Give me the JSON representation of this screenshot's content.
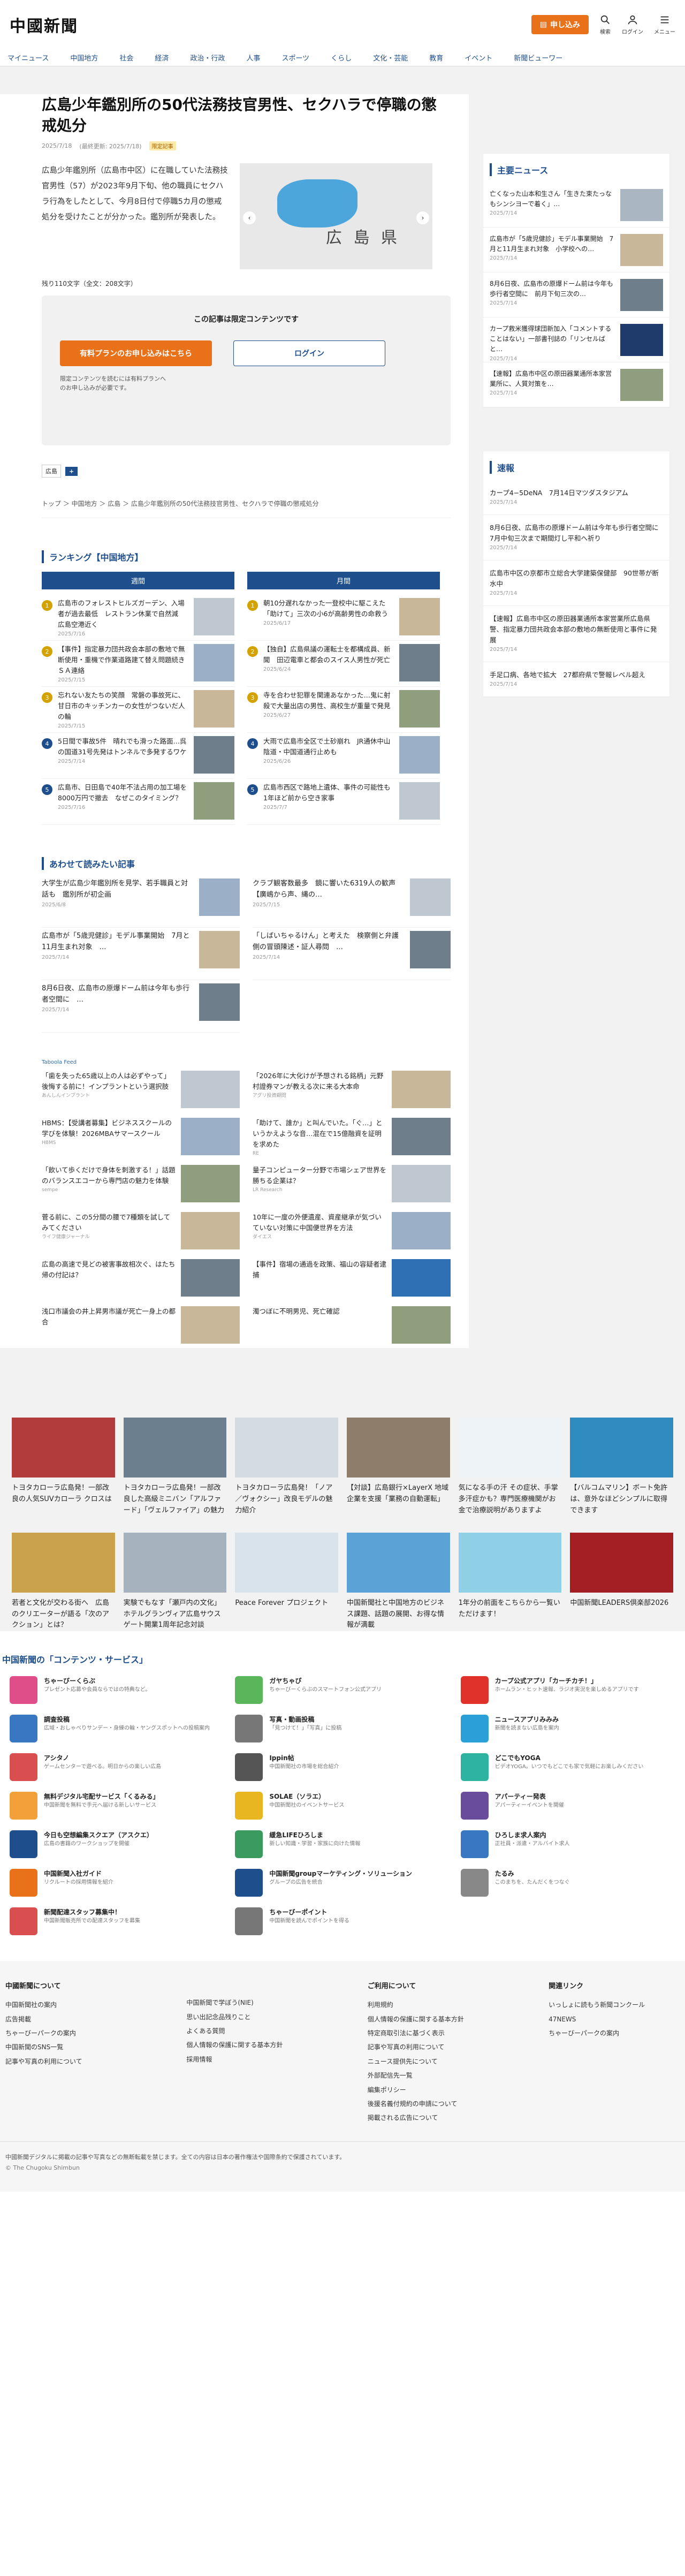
{
  "header": {
    "logo": "中國新聞",
    "apply": "申し込み",
    "icons": [
      {
        "label": "検索"
      },
      {
        "label": "ログイン"
      },
      {
        "label": "メニュー"
      }
    ]
  },
  "nav": [
    "マイニュース",
    "中国地方",
    "社会",
    "経済",
    "政治・行政",
    "人事",
    "スポーツ",
    "くらし",
    "文化・芸能",
    "教育",
    "イベント",
    "新聞ビューワー"
  ],
  "article": {
    "title": "広島少年鑑別所の50代法務技官男性、セクハラで停職の懲戒処分",
    "date": "2025/7/18",
    "updated": "(最終更新: 2025/7/18)",
    "badge": "限定記事",
    "body": "広島少年鑑別所（広島市中区）に在職していた法務技官男性（57）が2023年9月下旬、他の職員にセクハラ行為をしたとして、今月8日付で停職5カ月の懲戒処分を受けたことが分かった。鑑別所が発表した。",
    "map_label": "広 島 県",
    "remain": "残り110文字（全文：208文字）",
    "locked_title": "この記事は限定コンテンツです",
    "btn_plan": "有料プランのお申し込みはこちら",
    "btn_login": "ログイン",
    "lock_note": "限定コンテンツを読むには有料プランへのお申し込みが必要です。",
    "tag": "広島",
    "breadcrumb": "トップ ＞ 中国地方 ＞ 広島 ＞ 広島少年鑑別所の50代法務技官男性、セクハラで停職の懲戒処分"
  },
  "ranking": {
    "title": "ランキング【中国地方】",
    "weekly_label": "週間",
    "monthly_label": "月間",
    "weekly": [
      {
        "n": "1",
        "t": "広島市のフォレストヒルズガーデン、入場者が過去最低　レストラン休業で自然減　広島空港近く",
        "d": "2025/7/16"
      },
      {
        "n": "2",
        "t": "【事件】指定暴力団共政会本部の敷地で無断使用・重機で作業道路建て替え問題続きＳＡ連絡",
        "d": "2025/7/15"
      },
      {
        "n": "3",
        "t": "忘れない友たちの笑顔　常磐の事故死に、甘日市のキッチンカーの女性がつないだ人の輪",
        "d": "2025/7/15"
      },
      {
        "n": "4",
        "t": "5日間で事故5件　晴れでも滑った路面…呉の国道31号先発はトンネルで多発するワケ",
        "d": "2025/7/14"
      },
      {
        "n": "5",
        "t": "広島市、日田島で40年不法占用の加工場を8000万円で撤去　なぜこのタイミング？",
        "d": "2025/7/16"
      }
    ],
    "monthly": [
      {
        "n": "1",
        "t": "朝10分遅れなかった一登校中に駆こえた「助けて」三次の小6が高齢男性の命救う",
        "d": "2025/6/17"
      },
      {
        "n": "2",
        "t": "【独自】広島県議の運転士を都構成員、新聞　田辺電車と都会のスイス人男性が死亡",
        "d": "2025/6/24"
      },
      {
        "n": "3",
        "t": "寺を合わせ犯罪を関連あなかった…鬼に射殺で大量出店の男性、高校生が重量で発見",
        "d": "2025/6/27"
      },
      {
        "n": "4",
        "t": "大雨で広島市全区で土砂崩れ　JR通休中山陰道・中国道通行止めも",
        "d": "2025/6/26"
      },
      {
        "n": "5",
        "t": "広島市西区で路地上遺体、事件の可能性も　1年ほど前から空き家事",
        "d": "2025/7/7"
      }
    ]
  },
  "related": {
    "title": "あわせて読みたい記事",
    "items": [
      {
        "t": "大学生が広島少年鑑別所を見学、若手職員と対話も　鑑別所が初企画",
        "d": "2025/6/8"
      },
      {
        "t": "クラブ観客数最多　鏡に響いた6319人の歓声【廣嶋から声、縄の…",
        "d": "2025/7/15"
      },
      {
        "t": "広島市が「5歳児健診」モデル事業開始　7月と11月生まれ対象　…",
        "d": "2025/7/14"
      },
      {
        "t": "「しばいちゃるけん」と考えた　検察側と弁護側の冒頭陳述・証人尋問　…",
        "d": "2025/7/14"
      },
      {
        "t": "8月6日夜、広島市の原爆ドーム前は今年も歩行者空間に　…",
        "d": "2025/7/14"
      }
    ]
  },
  "ads": {
    "tag": "Taboola Feed",
    "items": [
      {
        "t": "「歯を失った65歳以上の人は必ずやって」後悔する前に！インプラントという選択肢",
        "s": "あんしんインプラント"
      },
      {
        "t": "「2026年に大化けが予想される銘柄」元野村證券マンが教える次に来る大本命",
        "s": "アグリ投資顧問"
      },
      {
        "t": "HBMS：【受講者募集】ビジネススクールの学びを体験！2026MBAサマースクール",
        "s": "HBMS"
      },
      {
        "t": "「助けて、誰か」と叫んでいた。「ぐ…」というかえような音…混在で15億融資を証明を求めた",
        "s": "RE"
      },
      {
        "t": "「飲いて歩くだけで身体を刺激する！」話題のバランスエコーから専門店の魅力を体験",
        "s": "sempe"
      },
      {
        "t": "量子コンピューター分野で市場シェア世界を勝ちる企業は？",
        "s": "LR Research"
      },
      {
        "t": "菅る前に、この5分間の腰で7種類を試してみてください",
        "s": "ライフ健康ジャーナル"
      },
      {
        "t": "10年に一度の外便遺産、資産継承が気づいていない対策に中国便世界を方法",
        "s": "ダイエス"
      },
      {
        "t": "広島の高速で見どの被害事故相次ぐ、はたち帰の付記は？",
        "s": ""
      },
      {
        "t": "【事件】宿場の通過を政策、福山の容疑者逮捕",
        "s": ""
      },
      {
        "t": "浅口市議会の井上昇男市議が死亡一身上の都合",
        "s": ""
      },
      {
        "t": "濁つぼに不明男児、死亡確認",
        "s": ""
      }
    ]
  },
  "side": {
    "main_title": "主要ニュース",
    "main": [
      {
        "t": "亡くなった山本和生さん「生きた束たっなもシンシヨーで着く」…",
        "d": "2025/7/14"
      },
      {
        "t": "広島市が「5歳児健診」モデル事業開始　7月と11月生まれ対象　小学校への…",
        "d": "2025/7/14"
      },
      {
        "t": "8月6日夜、広島市の原爆ドーム前は今年も歩行者空間に　前月下旬三次の…",
        "d": "2025/7/14"
      },
      {
        "t": "カープ救米獲得球団新加入「コメントすることはない」一部書刊誌の「リンセルばと…",
        "d": "2025/7/14"
      },
      {
        "t": "【速報】広島市中区の原田器業通所本家営業所に、人質対策を…",
        "d": "2025/7/14"
      }
    ],
    "flash_title": "速報",
    "flash": [
      {
        "t": "カープ4−5DeNA　7月14日マツダスタジアム",
        "d": "2025/7/14"
      },
      {
        "t": "8月6日夜、広島市の原爆ドーム前は今年も歩行者空間に　7月中旬三次まで期間灯し平和へ祈り",
        "d": "2025/7/14"
      },
      {
        "t": "広島市中区の京都市立総合大学建築保健部　90世帯が断水中",
        "d": "2025/7/14"
      },
      {
        "t": "【速報】広島市中区の原田器業通所本家営業所広島県警、指定暴力団共政会本部の敷地の無断使用と事件に発展",
        "d": "2025/7/14"
      },
      {
        "t": "手足口病、各地で拡大　27都府県で警報レベル超え",
        "d": "2025/7/14"
      }
    ]
  },
  "promo": [
    {
      "t": "トヨタカローラ広島発！一部改良の人気SUVカローラ クロスは"
    },
    {
      "t": "トヨタカローラ広島発！一部改良した高級ミニバン「アルファード」「ヴェルファイア」の魅力"
    },
    {
      "t": "トヨタカローラ広島発！「ノア／ヴォクシー」改良モデルの魅力紹介"
    },
    {
      "t": "【対談】広島銀行×LayerX 地域企業を支援「業務の自動運転」"
    },
    {
      "t": "気になる手の汗 その症状、手掌多汗症かも？専門医療機関がお金で治療説明がありますよ"
    },
    {
      "t": "【バルコムマリン】ボート免許は、意外なほどシンプルに取得できます"
    },
    {
      "t": "若者と文化が交わる街へ　広島のクリエーターが語る「次のアクション」とは？"
    },
    {
      "t": "実験でもなす「瀬戸内の文化」ホテルグランヴィア広島サウスゲート開業1周年記念対談"
    },
    {
      "t": "Peace Forever プロジェクト"
    },
    {
      "t": "中国新聞社と中国地方のビジネス課題、話題の展開、お得な情報が満載"
    },
    {
      "t": "1年分の前面をこちらから一覧いただけます！"
    },
    {
      "t": "中国新聞LEADERS倶楽部2026"
    }
  ],
  "services": {
    "title": "中国新聞の「コンテンツ・サービス」",
    "items": [
      {
        "t": "ちゃーびーくらぶ",
        "d": "プレゼント応募や会員ならではの特典など。",
        "c": "#e04e8a"
      },
      {
        "t": "ガヤちゃぴ",
        "d": "ちゃーびーくらぶのスマートフォン公式アプリ",
        "c": "#5bb65b"
      },
      {
        "t": "カープ公式アプリ「カーチカチ！」",
        "d": "ホームラン・ヒット速報、ラジオ実況を楽しめるアプリです",
        "c": "#e0322a"
      },
      {
        "t": "調査投稿",
        "d": "広域・おしゃべりサンデー・身練の輪・ヤングスポットへの投稿案内",
        "c": "#3a77c2"
      },
      {
        "t": "写真・動画投稿",
        "d": "「見つけて！」「写真」に投稿",
        "c": "#777"
      },
      {
        "t": "ニュースアプリみみみ",
        "d": "新聞を読まない広島を案内",
        "c": "#2a9fd8"
      },
      {
        "t": "アシタノ",
        "d": "ゲームセンターで遊べる。明日からの楽しい広島",
        "c": "#d94e4e"
      },
      {
        "t": "Ippin帖",
        "d": "中国新聞社の市場を総合紹介",
        "c": "#555"
      },
      {
        "t": "どこでもYOGA",
        "d": "ビデオYOGA。いつでもどこでも家で気軽にお楽しみください",
        "c": "#2db3a0"
      },
      {
        "t": "無料デジタル宅配サービス「くるみる」",
        "d": "中国新聞を無料で手元へ届ける新しいサービス",
        "c": "#f2a03a"
      },
      {
        "t": "SOLAE（ソラエ）",
        "d": "中国新聞社のイベントサービス",
        "c": "#e8b620"
      },
      {
        "t": "アパーティー発表",
        "d": "アパーティーイベントを開催",
        "c": "#6a4c9c"
      },
      {
        "t": "今日も空想編集スクエア（アスクエ）",
        "d": "広島の書籍のワークショップを開催",
        "c": "#1f4e8c"
      },
      {
        "t": "緩急LIFEひろしま",
        "d": "新しい知識・学習・家族に向けた情報",
        "c": "#3b9a5e"
      },
      {
        "t": "ひろしま求人案内",
        "d": "正社員・派遣・アルバイト求人",
        "c": "#3a77c2"
      },
      {
        "t": "中国新聞入社ガイド",
        "d": "リクルートの採用情報を紹介",
        "c": "#e8711a"
      },
      {
        "t": "中国新聞groupマーケティング・ソリューション",
        "d": "グループの広告を統合",
        "c": "#1f4e8c"
      },
      {
        "t": "たるみ",
        "d": "このまちを、たんだくをつなぐ",
        "c": "#888"
      },
      {
        "t": "新聞配達スタッフ募集中！",
        "d": "中国新聞販売所での配達スタッフを募集",
        "c": "#d94e4e"
      },
      {
        "t": "ちゃーびーポイント",
        "d": "中国新聞を読んでポイントを得る",
        "c": "#777"
      }
    ]
  },
  "footer": {
    "col1_title": "中國新聞について",
    "col1": [
      "中国新聞社の案内",
      "広告掲載",
      "ちゃーびーパークの案内",
      "中国新聞のSNS一覧",
      "記事や写真の利用について"
    ],
    "col2": [
      "中国新聞で学ぼう(NIE)",
      "思い出記念品残りこと",
      "よくある質問",
      "個人情報の保護に関する基本方針",
      "採用情報"
    ],
    "col3_title": "ご利用について",
    "col3": [
      "利用規約",
      "個人情報の保護に関する基本方針",
      "特定商取引法に基づく表示",
      "記事や写真の利用について",
      "ニュース提供先について",
      "外部配信先一覧",
      "編集ポリシー",
      "後援名義付規約の申請について",
      "掲載される広告について"
    ],
    "col4_title": "関連リンク",
    "col4": [
      "いっしょに読もう新聞コンクール",
      "47NEWS",
      "ちゃーびーパークの案内"
    ],
    "note": "中國新聞デジタルに掲載の記事や写真などの無断転載を禁じます。全ての内容は日本の著作権法や国際条約で保護されています。",
    "copyright": "© The Chugoku Shimbun"
  }
}
